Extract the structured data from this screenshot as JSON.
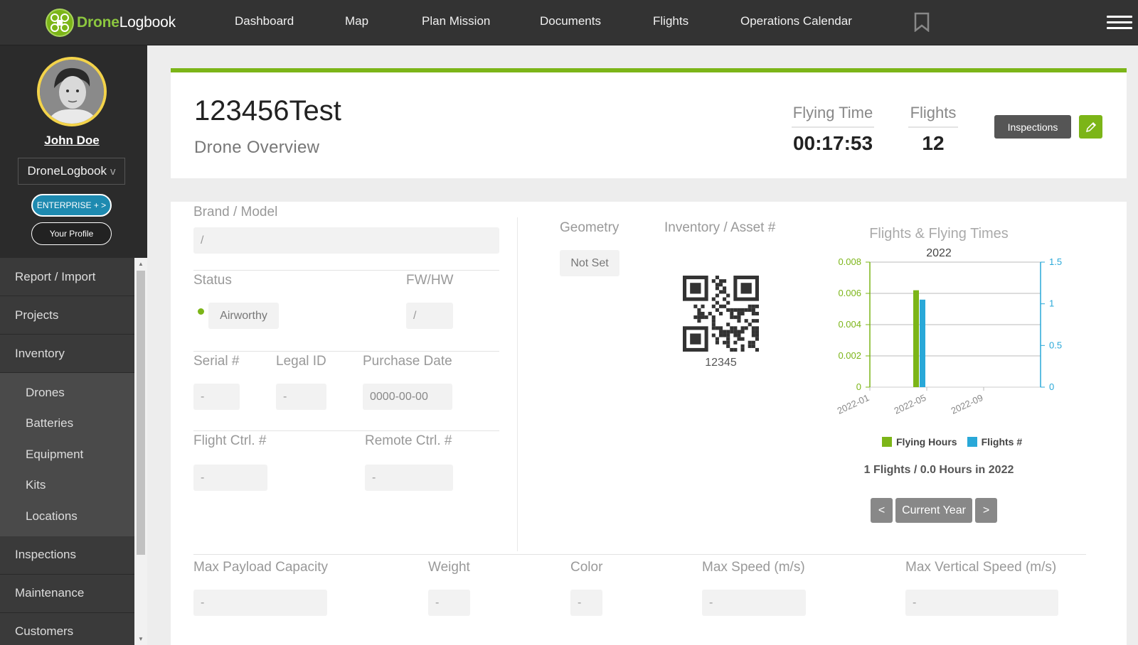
{
  "brand": {
    "name_green": "Drone",
    "name_white": "Logbook"
  },
  "nav": [
    "Dashboard",
    "Map",
    "Plan Mission",
    "Documents",
    "Flights",
    "Operations Calendar"
  ],
  "user": {
    "name": "John Doe",
    "org": "DroneLogbook",
    "org_chevron": "v",
    "plan": "ENTERPRISE + >",
    "profile": "Your Profile"
  },
  "sidebar_menu": {
    "report": "Report / Import",
    "projects": "Projects",
    "inventory": "Inventory",
    "inventory_sub": [
      "Drones",
      "Batteries",
      "Equipment",
      "Kits",
      "Locations"
    ],
    "inspections": "Inspections",
    "maintenance": "Maintenance",
    "customers": "Customers"
  },
  "drone": {
    "name": "123456Test",
    "subtitle": "Drone Overview",
    "flying_time_label": "Flying Time",
    "flying_time": "00:17:53",
    "flights_label": "Flights",
    "flights": "12",
    "inspections_btn": "Inspections"
  },
  "details": {
    "brand_model_label": "Brand / Model",
    "brand_model": "/",
    "status_label": "Status",
    "status": "Airworthy",
    "fwhw_label": "FW/HW",
    "fwhw": "/",
    "serial_label": "Serial #",
    "serial": "-",
    "legal_label": "Legal ID",
    "legal": "-",
    "purchase_label": "Purchase Date",
    "purchase": "0000-00-00",
    "flight_ctrl_label": "Flight Ctrl. #",
    "flight_ctrl": "-",
    "remote_ctrl_label": "Remote Ctrl. #",
    "remote_ctrl": "-",
    "geometry_label": "Geometry",
    "geometry": "Not Set",
    "asset_label": "Inventory / Asset #",
    "asset": "12345",
    "payload_label": "Max Payload Capacity",
    "payload": "-",
    "weight_label": "Weight",
    "weight": "-",
    "color_label": "Color",
    "color": "-",
    "speed_label": "Max Speed (m/s)",
    "speed": "-",
    "vspeed_label": "Max Vertical Speed (m/s)",
    "vspeed": "-"
  },
  "chart_data": {
    "type": "bar",
    "title": "Flights & Flying Times",
    "subtitle": "2022",
    "x_ticks": [
      "2022-01",
      "2022-05",
      "2022-09"
    ],
    "series": [
      {
        "name": "Flying Hours",
        "axis": "left",
        "color": "#7cb518",
        "x": "2022-04",
        "value": 0.0062
      },
      {
        "name": "Flights #",
        "axis": "right",
        "color": "#29a8d8",
        "x": "2022-04",
        "value": 1.05
      }
    ],
    "y_left": {
      "ticks": [
        0,
        0.002,
        0.004,
        0.006,
        0.008
      ],
      "range": [
        0,
        0.008
      ]
    },
    "y_right": {
      "ticks": [
        0,
        0.5,
        1,
        1.5
      ],
      "range": [
        0,
        1.5
      ]
    },
    "grid": true,
    "legend": "bottom"
  },
  "chart_summary": "1 Flights / 0.0 Hours in 2022",
  "chart_nav": {
    "prev": "<",
    "current": "Current Year",
    "next": ">"
  },
  "colors": {
    "accent": "#7cb518",
    "topbar": "#333333",
    "sidebar": "#2b2b2b",
    "flights_series": "#29a8d8"
  }
}
